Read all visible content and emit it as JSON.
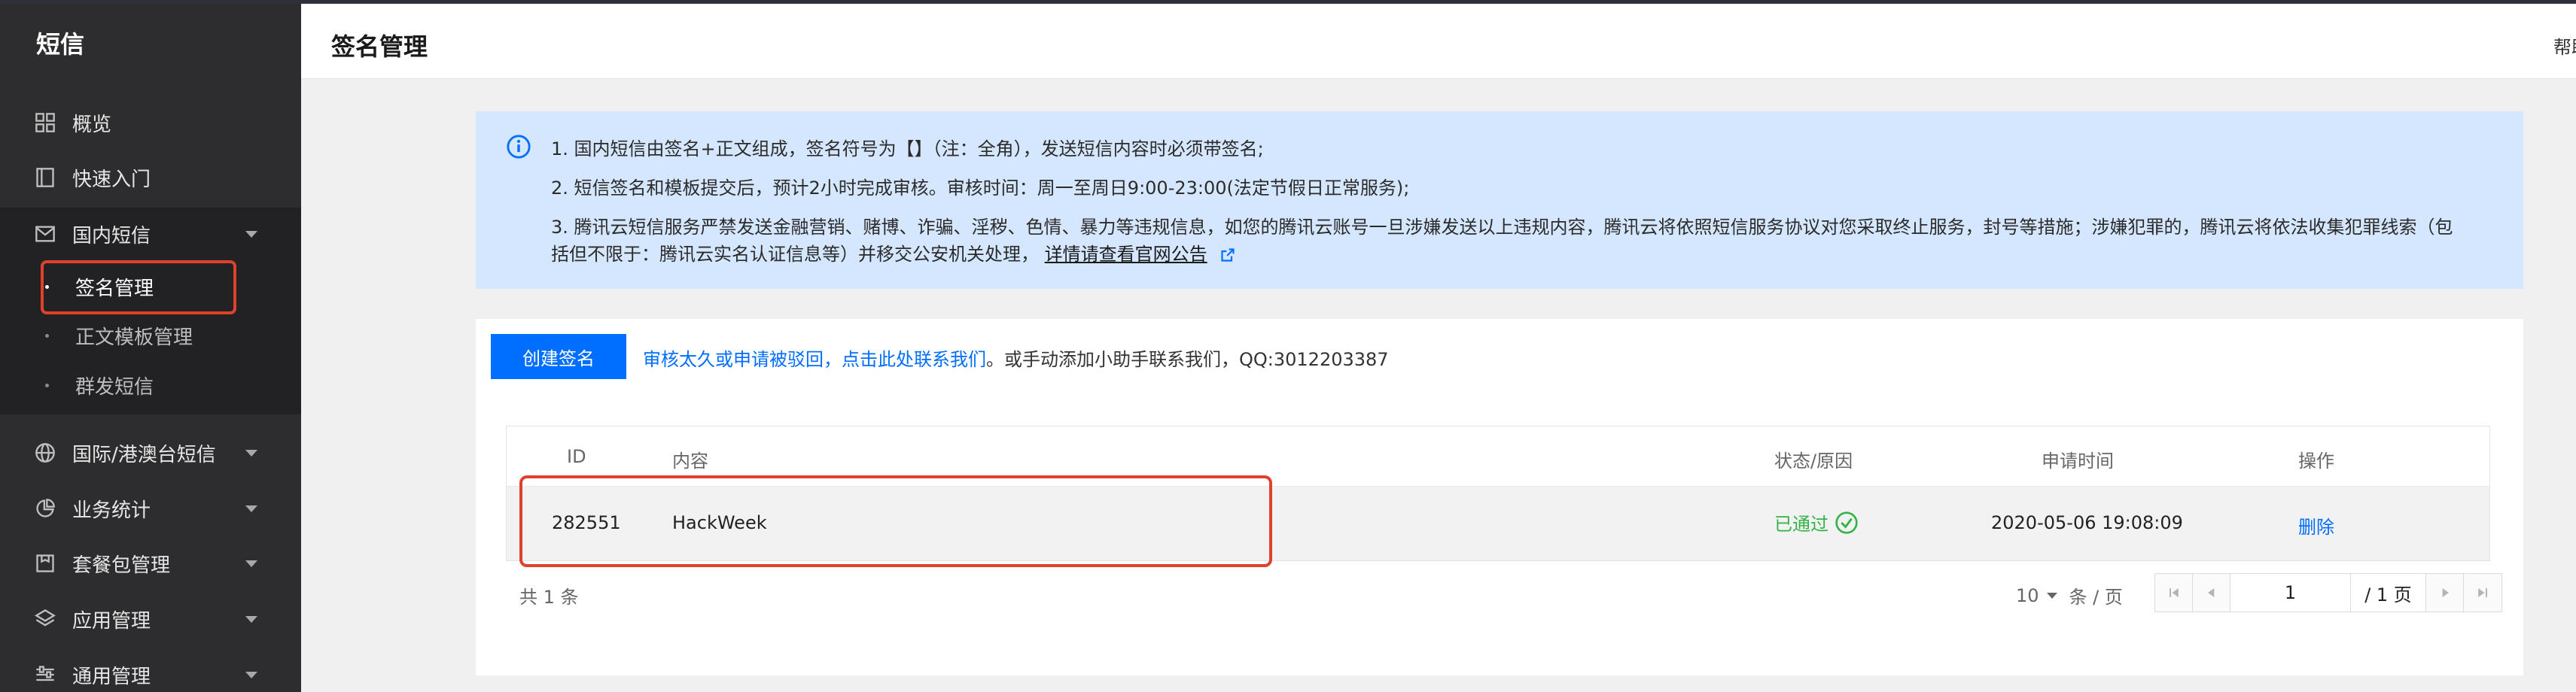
{
  "sidebar": {
    "brand": "短信",
    "items": [
      {
        "label": "概览",
        "icon": "grid-icon"
      },
      {
        "label": "快速入门",
        "icon": "book-icon"
      },
      {
        "label": "国内短信",
        "icon": "mail-icon"
      },
      {
        "label": "国际/港澳台短信",
        "icon": "globe-icon"
      },
      {
        "label": "业务统计",
        "icon": "pie-chart-icon"
      },
      {
        "label": "套餐包管理",
        "icon": "package-icon"
      },
      {
        "label": "应用管理",
        "icon": "layers-icon"
      },
      {
        "label": "通用管理",
        "icon": "sliders-icon"
      }
    ],
    "sub_items": [
      {
        "label": "签名管理"
      },
      {
        "label": "正文模板管理"
      },
      {
        "label": "群发短信"
      }
    ]
  },
  "header": {
    "title": "签名管理",
    "help": "帮助"
  },
  "notice": {
    "line1": "1. 国内短信由签名+正文组成，签名符号为【】（注：全角），发送短信内容时必须带签名;",
    "line2": "2. 短信签名和模板提交后，预计2小时完成审核。审核时间：周一至周日9:00-23:00(法定节假日正常服务);",
    "line3": "3. 腾讯云短信服务严禁发送金融营销、赌博、诈骗、淫秽、色情、暴力等违规信息，如您的腾讯云账号一旦涉嫌发送以上违规内容，腾讯云将依照短信服务协议对您采取终止服务，封号等措施；涉嫌犯罪的，腾讯云将依法收集犯罪线索（包",
    "line4": "括但不限于：腾讯云实名认证信息等）并移交公安机关处理，",
    "link": "详情请查看官网公告"
  },
  "toolbar": {
    "create_label": "创建签名",
    "hint_link": "审核太久或申请被驳回，点击此处联系我们",
    "hint_text": "。或手动添加小助手联系我们，QQ:3012203387"
  },
  "table": {
    "columns": {
      "id": "ID",
      "content": "内容",
      "status": "状态/原因",
      "time": "申请时间",
      "action": "操作"
    },
    "rows": [
      {
        "id": "282551",
        "content": "HackWeek",
        "status": "已通过",
        "time": "2020-05-06 19:08:09",
        "action": "删除"
      }
    ]
  },
  "pagination": {
    "total": "共 1 条",
    "page_size": "10",
    "page_size_unit": "条 / 页",
    "current_page": "1",
    "total_pages": "/ 1 页"
  },
  "colors": {
    "accent": "#006eff",
    "success": "#34b34a",
    "highlight": "#e0412c"
  }
}
